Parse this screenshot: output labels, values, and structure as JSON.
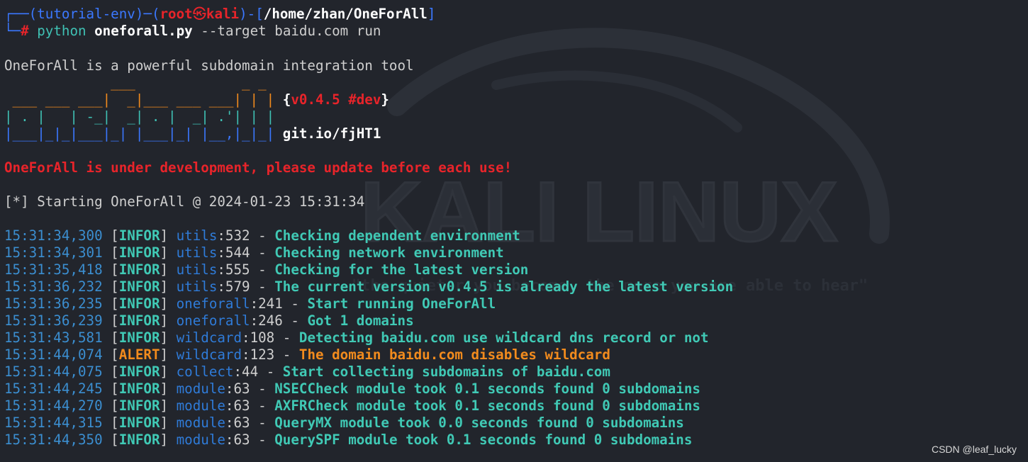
{
  "prompt": {
    "env": "tutorial-env",
    "user": "root",
    "at_glyph": "㉿",
    "host": "kali",
    "cwd": "/home/zhan/OneForAll",
    "hash": "#",
    "cmd_python": "python",
    "cmd_script": "oneforall.py",
    "cmd_args": "--target baidu.com run"
  },
  "intro": "OneForAll is a powerful subdomain integration tool",
  "banner": {
    "art_line1": "             ___             _ _",
    "art_line2": " ___ ___ ___|  _|___ ___ ___| | |",
    "art_line3": "| . |   | -_|  _| . |  _| .'| | |",
    "art_line4": "|___|_|_|___|_| |___|_| |__,|_|_|",
    "version": "v0.4.5 #dev",
    "link": "git.io/fjHT1"
  },
  "warning": "OneForAll is under development, please update before each use!",
  "starting": "[*] Starting OneForAll @ 2024-01-23 15:31:34",
  "logs": [
    {
      "ts": "15:31:34,300",
      "level": "INFOR",
      "module": "utils",
      "lineno": "532",
      "msg": "Checking dependent environment"
    },
    {
      "ts": "15:31:34,301",
      "level": "INFOR",
      "module": "utils",
      "lineno": "544",
      "msg": "Checking network environment"
    },
    {
      "ts": "15:31:35,418",
      "level": "INFOR",
      "module": "utils",
      "lineno": "555",
      "msg": "Checking for the latest version"
    },
    {
      "ts": "15:31:36,232",
      "level": "INFOR",
      "module": "utils",
      "lineno": "579",
      "msg": "The current version v0.4.5 is already the latest version"
    },
    {
      "ts": "15:31:36,235",
      "level": "INFOR",
      "module": "oneforall",
      "lineno": "241",
      "msg": "Start running OneForAll"
    },
    {
      "ts": "15:31:36,239",
      "level": "INFOR",
      "module": "oneforall",
      "lineno": "246",
      "msg": "Got 1 domains"
    },
    {
      "ts": "15:31:43,581",
      "level": "INFOR",
      "module": "wildcard",
      "lineno": "108",
      "msg": "Detecting baidu.com use wildcard dns record or not"
    },
    {
      "ts": "15:31:44,074",
      "level": "ALERT",
      "module": "wildcard",
      "lineno": "123",
      "msg": "The domain baidu.com disables wildcard"
    },
    {
      "ts": "15:31:44,075",
      "level": "INFOR",
      "module": "collect",
      "lineno": "44",
      "msg": "Start collecting subdomains of baidu.com"
    },
    {
      "ts": "15:31:44,245",
      "level": "INFOR",
      "module": "module",
      "lineno": "63",
      "msg": "NSECCheck module took 0.1 seconds found 0 subdomains"
    },
    {
      "ts": "15:31:44,270",
      "level": "INFOR",
      "module": "module",
      "lineno": "63",
      "msg": "AXFRCheck module took 0.1 seconds found 0 subdomains"
    },
    {
      "ts": "15:31:44,315",
      "level": "INFOR",
      "module": "module",
      "lineno": "63",
      "msg": "QueryMX module took 0.0 seconds found 0 subdomains"
    },
    {
      "ts": "15:31:44,350",
      "level": "INFOR",
      "module": "module",
      "lineno": "63",
      "msg": "QuerySPF module took 0.1 seconds found 0 subdomains"
    }
  ],
  "watermark": {
    "title": "KALI LINUX",
    "quote": "\"the quieter you become, the more you are able to hear\""
  },
  "credit": "CSDN @leaf_lucky",
  "colors": {
    "background": "#22252c",
    "prompt_blue": "#3b78ff",
    "root_red": "#e8242a",
    "timestamp": "#3b8ed0",
    "message": "#40c9b5",
    "alert": "#f28b1d"
  }
}
